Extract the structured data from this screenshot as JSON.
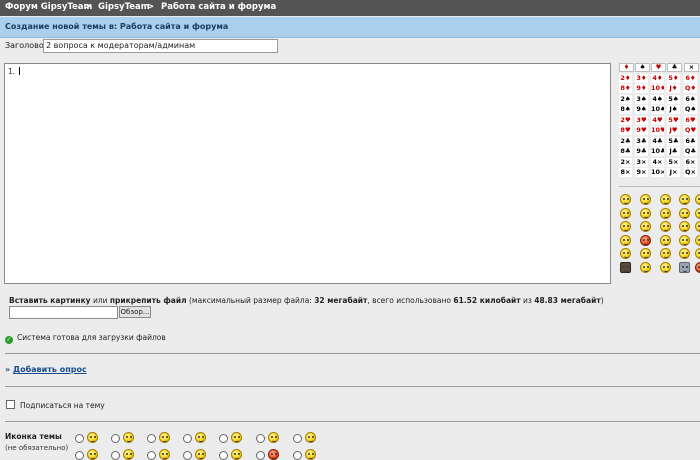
{
  "breadcrumb": {
    "forum": "Форум GipsyTeam",
    "sep1": ">",
    "section": "GipsyTeam",
    "sep2": ">",
    "subsection": "Работа сайта и форума"
  },
  "subheader": "Создание новой темы в: Работа сайта и форума",
  "title_label": "Заголовок:",
  "title_value": "2 вопроса к модераторам/админам",
  "editor_text": "1.",
  "cards": {
    "suits": [
      {
        "sym": "♦",
        "red": true
      },
      {
        "sym": "♠",
        "red": false
      },
      {
        "sym": "♥",
        "red": true
      },
      {
        "sym": "♣",
        "red": false
      },
      {
        "sym": "×",
        "red": false
      }
    ],
    "rows": [
      [
        "2♦",
        "3♦",
        "4♦",
        "5♦",
        "6♦"
      ],
      [
        "8♦",
        "9♦",
        "10♦",
        "J♦",
        "Q♦"
      ],
      [
        "2♠",
        "3♠",
        "4♠",
        "5♠",
        "6♠"
      ],
      [
        "8♠",
        "9♠",
        "10♠",
        "J♠",
        "Q♠"
      ],
      [
        "2♥",
        "3♥",
        "4♥",
        "5♥",
        "6♥"
      ],
      [
        "8♥",
        "9♥",
        "10♥",
        "J♥",
        "Q♥"
      ],
      [
        "2♣",
        "3♣",
        "4♣",
        "5♣",
        "6♣"
      ],
      [
        "8♣",
        "9♣",
        "10♣",
        "J♣",
        "Q♣"
      ],
      [
        "2×",
        "3×",
        "4×",
        "5×",
        "6×"
      ],
      [
        "8×",
        "9×",
        "10×",
        "J×",
        "Q×"
      ]
    ]
  },
  "upload": {
    "label_insert": "Вставить картинку",
    "label_or": " или ",
    "label_attach": "прикрепить файл",
    "info_prefix": " (максимальный размер файла: ",
    "max_size": "32 мегабайт",
    "info_mid": ", всего использовано ",
    "used": "61.52 килобайт",
    "info_of": " из ",
    "total": "48.83 мегабайт",
    "info_suffix": ")",
    "browse_label": "Обзор..."
  },
  "ready_text": "Система готова для загрузки файлов",
  "add_poll_prefix": "» ",
  "add_poll_link": "Добавить опрос",
  "subscribe_label": "Подписаться на тему",
  "icon_label": "Иконка темы",
  "icon_sub": "(не обязательно)"
}
